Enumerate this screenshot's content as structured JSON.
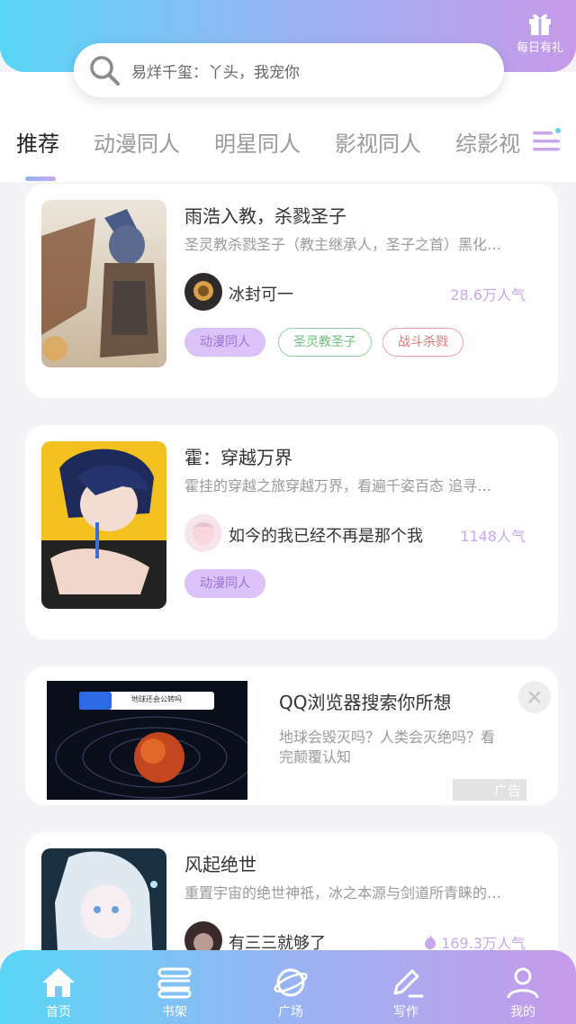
{
  "header": {
    "search_placeholder": "易烊千玺：丫头，我宠你",
    "gift_label": "每日有礼"
  },
  "tabs": [
    {
      "label": "推荐",
      "active": true
    },
    {
      "label": "动漫同人",
      "active": false
    },
    {
      "label": "明星同人",
      "active": false
    },
    {
      "label": "影视同人",
      "active": false
    },
    {
      "label": "综影视",
      "active": false
    }
  ],
  "books": [
    {
      "title": "雨浩入教，杀戮圣子",
      "desc": "圣灵教杀戮圣子（教主继承人，圣子之首）黑化…",
      "author": "冰封可一",
      "popularity": "28.6万人气",
      "tags": [
        {
          "label": "动漫同人",
          "style": "purple"
        },
        {
          "label": "圣灵教圣子",
          "style": "green"
        },
        {
          "label": "战斗杀戮",
          "style": "red"
        }
      ]
    },
    {
      "title": "霍：穿越万界",
      "desc": "霍挂的穿越之旅穿越万界，看遍千姿百态 追寻…",
      "author": "如今的我已经不再是那个我",
      "popularity": "1148人气",
      "tags": [
        {
          "label": "动漫同人",
          "style": "purple"
        }
      ]
    },
    {
      "title": "风起绝世",
      "desc": "重置宇宙的绝世神祇，冰之本源与剑道所青睐的…",
      "author": "有三三就够了",
      "popularity": "169.3万人气"
    }
  ],
  "ad": {
    "title": "QQ浏览器搜索你所想",
    "desc": "地球会毁灭吗？人类会灭绝吗？看完颠覆认知",
    "badge": "广告",
    "image_search_text": "地球还会公转吗"
  },
  "bottom_nav": [
    {
      "label": "首页",
      "icon": "home-icon"
    },
    {
      "label": "书架",
      "icon": "bookshelf-icon"
    },
    {
      "label": "广场",
      "icon": "planet-icon"
    },
    {
      "label": "写作",
      "icon": "pen-icon"
    },
    {
      "label": "我的",
      "icon": "user-icon"
    }
  ],
  "colors": {
    "gradient_start": "#58d6f6",
    "gradient_end": "#c69ae9",
    "popularity": "#c8a8ee",
    "tag_purple": "#dcc3f7"
  }
}
